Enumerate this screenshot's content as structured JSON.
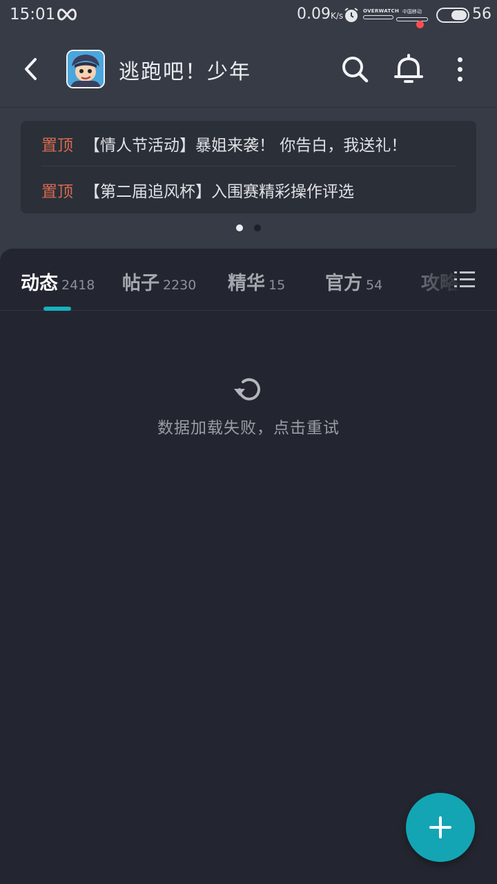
{
  "status_bar": {
    "time": "15:01",
    "net_speed": "0.09",
    "net_speed_unit": "K/s",
    "app_badge_text": "OVERWATCH",
    "carrier_text": "中国移动",
    "battery_level": "56",
    "battery_fraction": 0.56
  },
  "header": {
    "title": "逃跑吧！少年",
    "has_notification": true
  },
  "pinned": {
    "items": [
      {
        "tag": "置顶",
        "text": "【情人节活动】暴姐来袭！ 你告白，我送礼！"
      },
      {
        "tag": "置顶",
        "text": "【第二届追风杯】入围赛精彩操作评选"
      }
    ],
    "pager": {
      "total": 2,
      "active": 1
    }
  },
  "tabs": [
    {
      "label": "动态",
      "count": "2418",
      "active": true
    },
    {
      "label": "帖子",
      "count": "2230",
      "active": false
    },
    {
      "label": "精华",
      "count": "15",
      "active": false
    },
    {
      "label": "官方",
      "count": "54",
      "active": false
    },
    {
      "label": "攻略",
      "count": "",
      "active": false
    }
  ],
  "empty_state": {
    "message": "数据加载失败，点击重试",
    "icon": "refresh-icon"
  },
  "fab": {
    "icon": "plus-icon"
  },
  "colors": {
    "accent": "#13a5b4",
    "pinned_tag": "#d56a50",
    "notification_dot": "#ff4d4f",
    "page_bg": "#232630",
    "header_bg": "#363b46"
  }
}
